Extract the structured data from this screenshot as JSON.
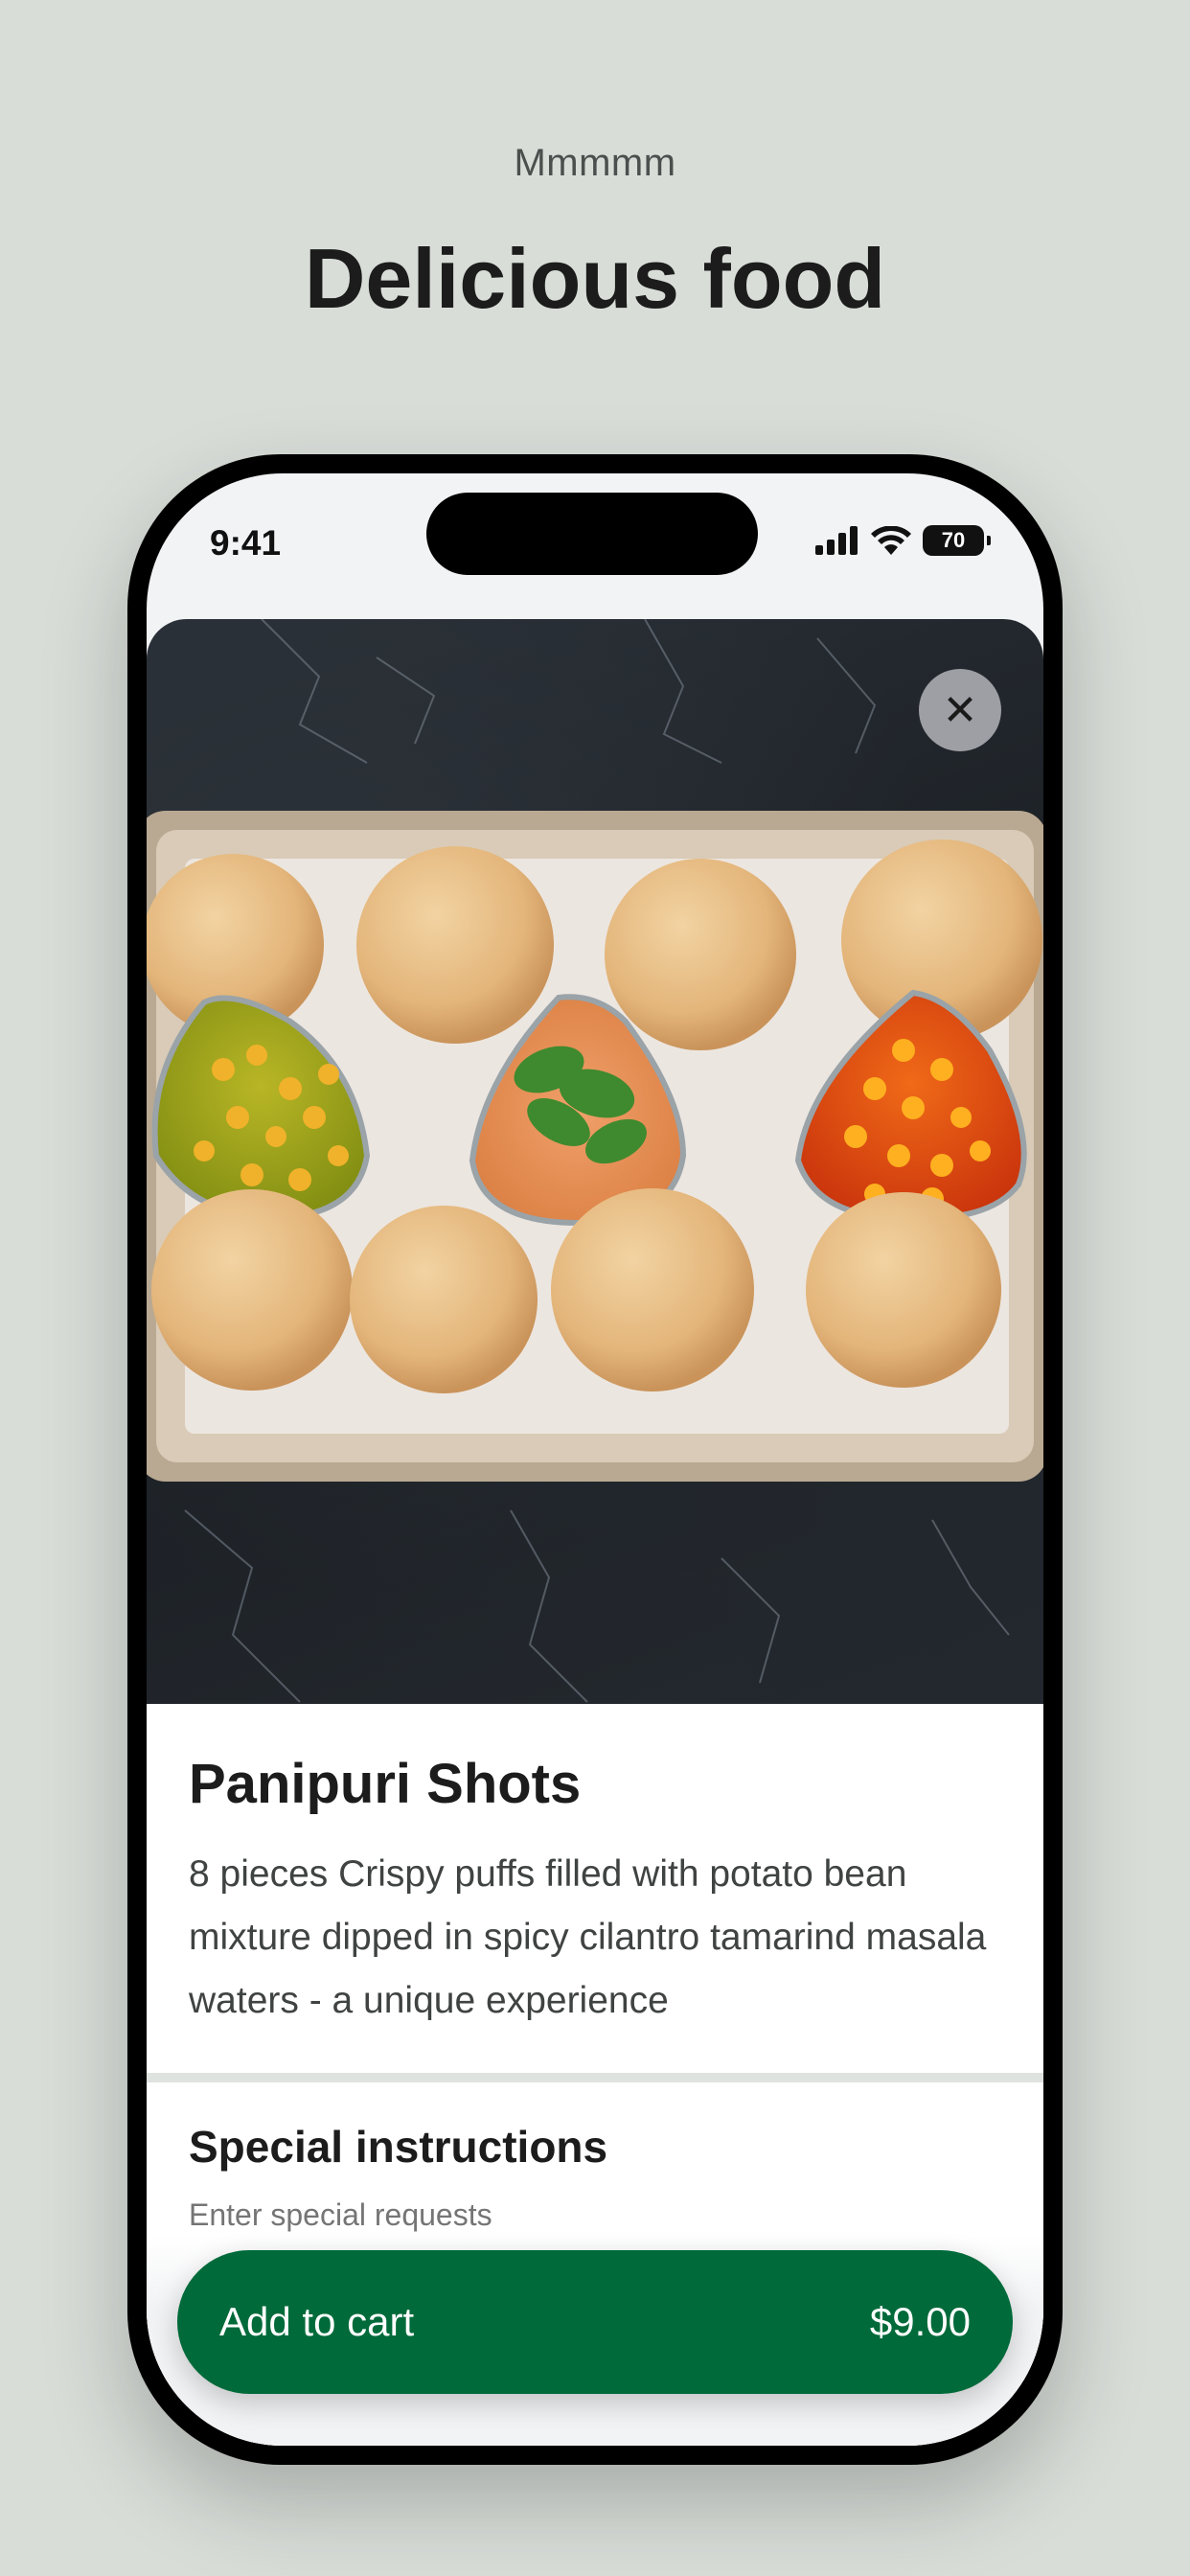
{
  "page": {
    "eyebrow": "Mmmmm",
    "headline": "Delicious food"
  },
  "status_bar": {
    "time": "9:41",
    "battery": "70",
    "icons": [
      "signal-icon",
      "wifi-icon",
      "battery-icon"
    ]
  },
  "item": {
    "image_alt": "Panipuri tray with puris and three dips",
    "close_icon": "close-icon",
    "title": "Panipuri Shots",
    "description": "8 pieces Crispy puffs filled with potato bean mixture dipped in spicy cilantro tamarind masala waters - a unique experience"
  },
  "special_instructions": {
    "title": "Special instructions",
    "placeholder": "Enter special requests"
  },
  "cart": {
    "label": "Add to cart",
    "price": "$9.00"
  },
  "colors": {
    "background": "#d8ddd8",
    "accent": "#006a3a",
    "marble": "#1f2429"
  }
}
